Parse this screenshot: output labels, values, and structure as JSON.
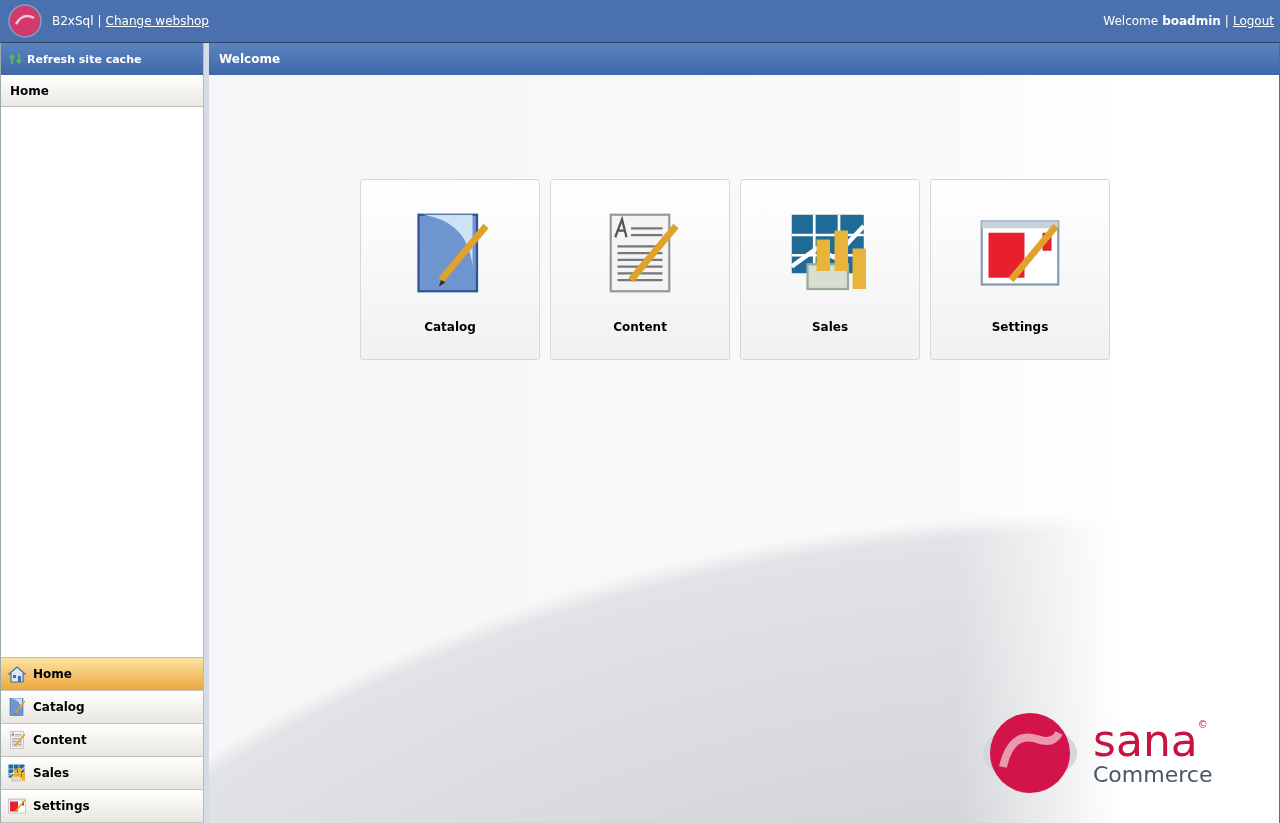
{
  "header": {
    "site": "B2xSql",
    "separator": "|",
    "change_link": "Change webshop",
    "welcome": "Welcome",
    "user": "boadmin",
    "separator_2": "|",
    "logout": "Logout"
  },
  "sidebar": {
    "refresh": "Refresh site cache",
    "section": "Home",
    "nav": [
      {
        "label": "Home",
        "kind": "home",
        "selected": true
      },
      {
        "label": "Catalog",
        "kind": "catalog",
        "selected": false
      },
      {
        "label": "Content",
        "kind": "content",
        "selected": false
      },
      {
        "label": "Sales",
        "kind": "sales",
        "selected": false
      },
      {
        "label": "Settings",
        "kind": "settings",
        "selected": false
      }
    ]
  },
  "main": {
    "title": "Welcome",
    "tiles": [
      {
        "label": "Catalog",
        "kind": "catalog"
      },
      {
        "label": "Content",
        "kind": "content"
      },
      {
        "label": "Sales",
        "kind": "sales"
      },
      {
        "label": "Settings",
        "kind": "settings"
      }
    ]
  },
  "brand": {
    "name": "sana",
    "sub": "Commerce",
    "mark": "©"
  }
}
